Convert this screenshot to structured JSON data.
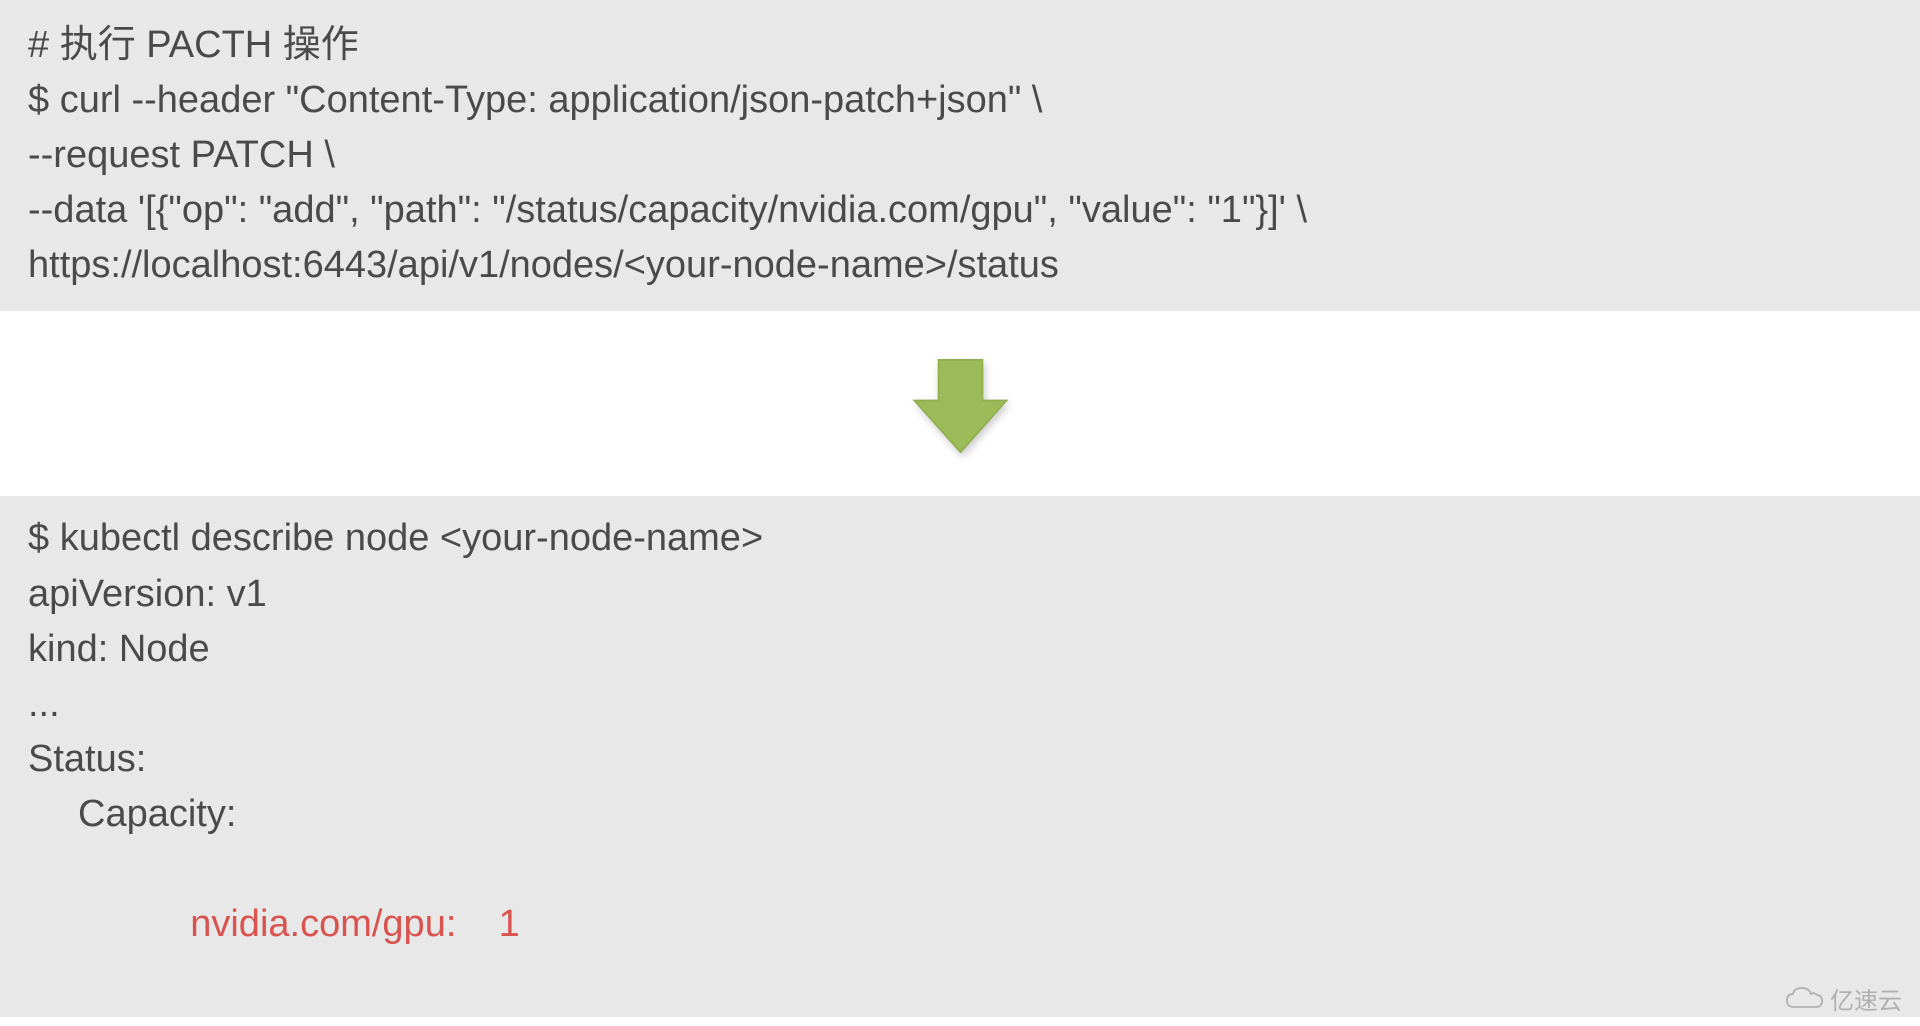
{
  "block1": {
    "line1": "# 执行 PACTH 操作",
    "line2": "$ curl --header \"Content-Type: application/json-patch+json\" \\",
    "line3": "--request PATCH \\",
    "line4": "--data '[{\"op\": \"add\", \"path\": \"/status/capacity/nvidia.com/gpu\", \"value\": \"1\"}]' \\",
    "line5": "https://localhost:6443/api/v1/nodes/<your-node-name>/status"
  },
  "block2": {
    "line1": "$ kubectl describe node <your-node-name>",
    "line2": "apiVersion: v1",
    "line3": "kind: Node",
    "line4": "...",
    "line5": "Status:",
    "line6": "Capacity:",
    "line7_key": "nvidia.com/gpu:",
    "line7_val": "1"
  },
  "watermark": {
    "text": "亿速云"
  }
}
